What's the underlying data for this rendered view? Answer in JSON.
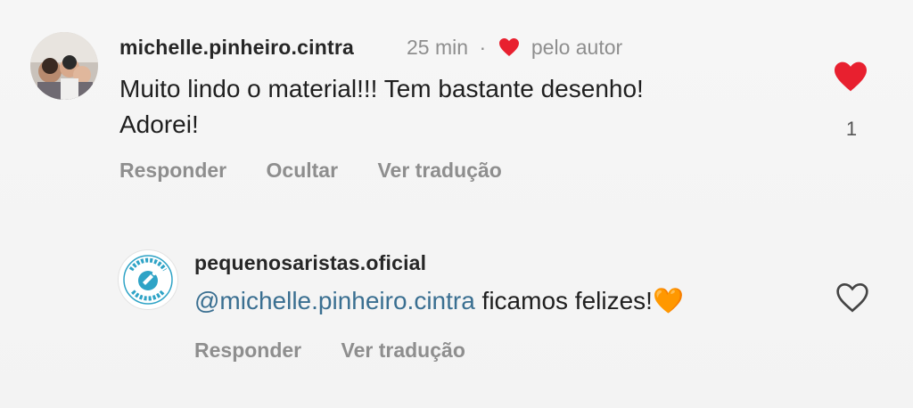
{
  "comment": {
    "username": "michelle.pinheiro.cintra",
    "time": "25 min",
    "separator": "·",
    "liked_by_label": "pelo autor",
    "text_line1": "Muito lindo o material!!! Tem bastante desenho!",
    "text_line2": "Adorei!",
    "like_count": "1",
    "actions": {
      "reply": "Responder",
      "hide": "Ocultar",
      "translate": "Ver tradução"
    },
    "like_state": "liked",
    "like_color": "#e8202f"
  },
  "reply": {
    "username": "pequenosaristas.oficial",
    "avatar_text": "PEQUENOS ARTISTAS",
    "mention": "@michelle.pinheiro.cintra",
    "text": " ficamos felizes!",
    "emoji": "🧡",
    "like_state": "not-liked",
    "actions": {
      "reply": "Responder",
      "translate": "Ver tradução"
    },
    "brand_color": "#2ea3c6"
  }
}
